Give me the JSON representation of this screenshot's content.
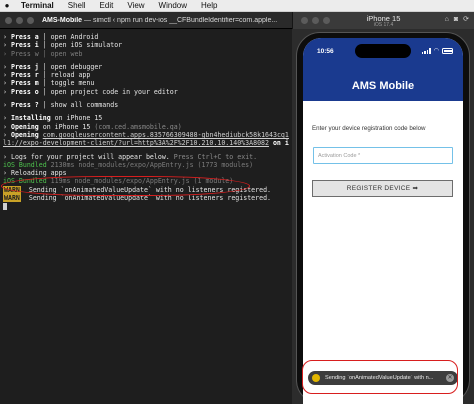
{
  "menubar": {
    "app": "Terminal",
    "items": [
      "Shell",
      "Edit",
      "View",
      "Window",
      "Help"
    ]
  },
  "terminal": {
    "title_bold": "AMS-Mobile",
    "title_rest": " — simctl ‹ npm run dev-ios __CFBundleIdentifier=com.apple...",
    "lines": {
      "l1": {
        "b": "›",
        "k": "Press a",
        "t": " │ open Android"
      },
      "l2": {
        "b": "›",
        "k": "Press i",
        "t": " │ open iOS simulator"
      },
      "l3": {
        "b": "›",
        "k": "Press w",
        "t": " │ open web"
      },
      "l4": {
        "b": "›",
        "k": "Press j",
        "t": " │ open debugger"
      },
      "l5": {
        "b": "›",
        "k": "Press r",
        "t": " │ reload app"
      },
      "l6": {
        "b": "›",
        "k": "Press m",
        "t": " │ toggle menu"
      },
      "l7": {
        "b": "›",
        "k": "Press o",
        "t": " │ open project code in your editor"
      },
      "l8": {
        "b": "›",
        "k": "Press ?",
        "t": " │ show all commands"
      },
      "l9": {
        "b": "›",
        "k": "Installing",
        "t": " on iPhone 15"
      },
      "l10": {
        "b": "›",
        "k": "Opening",
        "t": " on iPhone 15 ",
        "g": "(com.ced.amsmobile.qa)"
      },
      "l11": {
        "b": "›",
        "k": "Opening",
        "hl": "com.googleusercontent.apps.835766309488-gbn4hediubck58k1643cq13hsbrrs"
      },
      "l12": {
        "hl": "l1://expo-development-client/?url=http%3A%2F%2F10.210.10.140%3A8082",
        "k": " on iPhone 15"
      },
      "l13": {
        "b": "›",
        "t": "Logs for your project will appear below. ",
        "g": "Press Ctrl+C to exit."
      },
      "l14": {
        "gr": "iOS Bundled",
        "t": " 2130ms node_modules/expo/AppEntry.js (1773 modules)"
      },
      "l15": {
        "b": "›",
        "t": "Reloading apps"
      },
      "l16": {
        "gr": "iOS Bundled",
        "t": " 119ms node_modules/expo/AppEntry.js (1 module)"
      },
      "l17": {
        "w": "WARN",
        "t": " Sending `onAnimatedValueUpdate` with no listeners registered."
      },
      "l18": {
        "w": "WARN",
        "t": " Sending `onAnimatedValueUpdate` with no listeners registered."
      }
    }
  },
  "simulator": {
    "device": "iPhone 15",
    "os": "iOS 17.4",
    "status_time": "10:56",
    "app_title": "AMS Mobile",
    "prompt": "Enter your device registration code below",
    "input_placeholder": "Activation Code *",
    "register_label": "REGISTER DEVICE ➡",
    "toast_message": "Sending `onAnimatedValueUpdate` with n..."
  },
  "colors": {
    "header_blue": "#1a3a8f",
    "annotation_red": "#d81e1e",
    "warn_yellow": "#c9a227",
    "terminal_bg": "#1e1e1e"
  }
}
